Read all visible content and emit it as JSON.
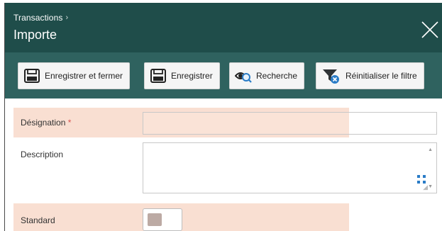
{
  "header": {
    "breadcrumb": "Transactions",
    "breadcrumb_separator": "›",
    "title": "Importe"
  },
  "toolbar": {
    "save_close_label": "Enregistrer et fermer",
    "save_label": "Enregistrer",
    "search_label": "Recherche",
    "reset_filter_label": "Réinitialiser le filtre"
  },
  "form": {
    "designation_label": "Désignation",
    "required_marker": "*",
    "designation_value": "",
    "description_label": "Description",
    "description_value": "",
    "standard_label": "Standard",
    "standard_value": false
  },
  "colors": {
    "header_bg": "#1f4d4a",
    "toolbar_bg": "#2f625f",
    "highlight_bg": "#f9dfd2",
    "required": "#d9534f"
  },
  "icons": [
    "chevron-right-icon",
    "close-icon",
    "save-icon",
    "search-eye-icon",
    "filter-reset-icon",
    "expand-icon"
  ]
}
